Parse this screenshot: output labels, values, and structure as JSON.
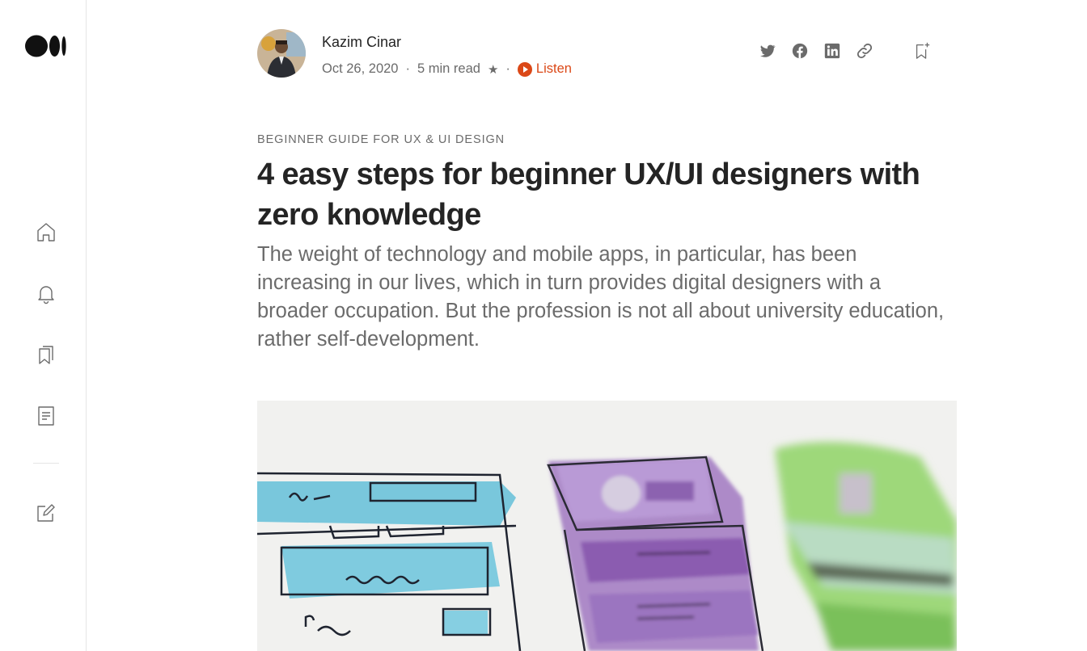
{
  "sidebar": {
    "logo_icon": "medium-logo",
    "items": [
      {
        "icon": "home-icon"
      },
      {
        "icon": "bell-icon"
      },
      {
        "icon": "bookmarks-icon"
      },
      {
        "icon": "stories-icon"
      },
      {
        "icon": "write-icon"
      }
    ]
  },
  "author": {
    "name": "Kazim Cinar",
    "date": "Oct 26, 2020",
    "sep1": "·",
    "read_time": "5 min read",
    "star": "★",
    "sep2": "·",
    "listen_label": "Listen"
  },
  "share_icons": [
    "twitter-icon",
    "facebook-icon",
    "linkedin-icon",
    "link-icon",
    "bookmark-add-icon"
  ],
  "article": {
    "kicker": "BEGINNER GUIDE FOR UX & UI DESIGN",
    "title": "4 easy steps for beginner UX/UI designers with zero knowledge",
    "subtitle": "The weight of technology and mobile apps, in particular, has been increasing in our lives, which in turn provides digital designers with a broader occupation. But the profession is not all about university education, rather self-development."
  },
  "colors": {
    "accent": "#db4817",
    "text": "#242424",
    "muted": "#6b6b6b",
    "divider": "#e6e6e6"
  }
}
